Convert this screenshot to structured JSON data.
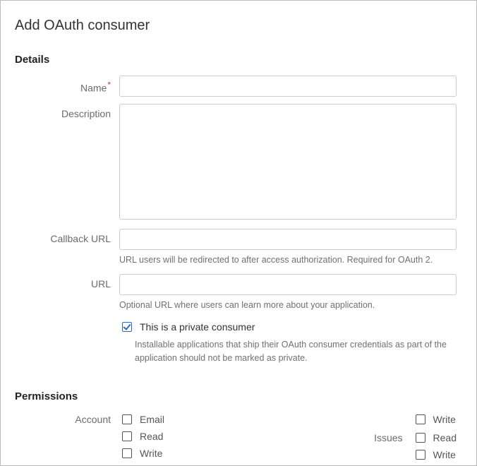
{
  "title": "Add OAuth consumer",
  "sections": {
    "details": "Details",
    "permissions": "Permissions"
  },
  "fields": {
    "name": {
      "label": "Name",
      "value": ""
    },
    "description": {
      "label": "Description",
      "value": ""
    },
    "callback": {
      "label": "Callback URL",
      "value": "",
      "help": "URL users will be redirected to after access authorization. Required for OAuth 2."
    },
    "url": {
      "label": "URL",
      "value": "",
      "help": "Optional URL where users can learn more about your application."
    },
    "private": {
      "label": "This is a private consumer",
      "checked": true,
      "help": "Installable applications that ship their OAuth consumer credentials as part of the application should not be marked as private."
    }
  },
  "permissions": {
    "account": {
      "label": "Account",
      "options": [
        {
          "key": "email",
          "label": "Email",
          "checked": false
        },
        {
          "key": "read",
          "label": "Read",
          "checked": false
        },
        {
          "key": "write",
          "label": "Write",
          "checked": false
        }
      ]
    },
    "col2top": {
      "options": [
        {
          "key": "write",
          "label": "Write",
          "checked": false
        }
      ]
    },
    "issues": {
      "label": "Issues",
      "options": [
        {
          "key": "read",
          "label": "Read",
          "checked": false
        },
        {
          "key": "write",
          "label": "Write",
          "checked": false
        }
      ]
    }
  }
}
